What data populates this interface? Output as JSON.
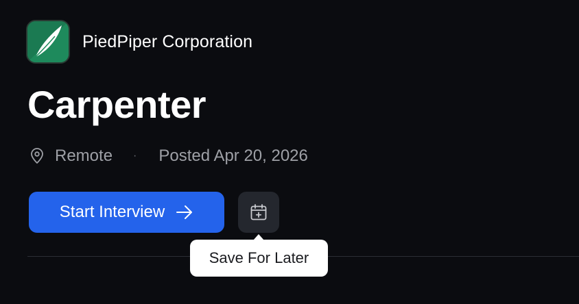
{
  "company": {
    "name": "PiedPiper Corporation",
    "logo_icon": "feather-logo-icon",
    "logo_color": "#1e8a5c"
  },
  "job": {
    "title": "Carpenter",
    "location": "Remote",
    "separator": "·",
    "posted": "Posted Apr 20, 2026"
  },
  "actions": {
    "start_label": "Start Interview",
    "start_icon": "arrow-right-icon",
    "start_color": "#2463eb",
    "save_icon": "calendar-plus-icon",
    "save_tooltip": "Save For Later"
  },
  "theme": {
    "background": "#0b0c10",
    "muted_text": "#9ea0a6"
  }
}
